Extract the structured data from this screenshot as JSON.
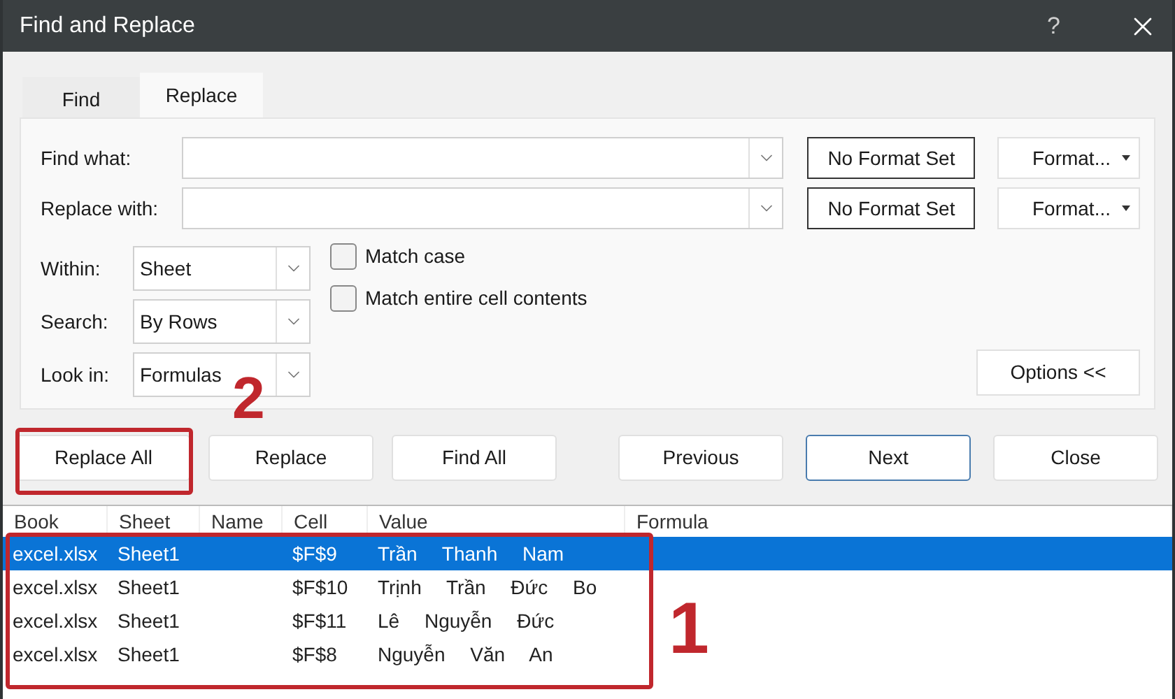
{
  "window": {
    "title": "Find and Replace",
    "help": "?"
  },
  "tabs": [
    {
      "label": "Find",
      "selected": false
    },
    {
      "label": "Replace",
      "selected": true
    }
  ],
  "fields": [
    {
      "label": "Find what:",
      "format_status": "No Format Set",
      "format_button": "Format..."
    },
    {
      "label": "Replace with:",
      "format_status": "No Format Set",
      "format_button": "Format..."
    }
  ],
  "selects": [
    {
      "label": "Within:",
      "value": "Sheet"
    },
    {
      "label": "Search:",
      "value": "By Rows"
    },
    {
      "label": "Look in:",
      "value": "Formulas"
    }
  ],
  "checkboxes": [
    {
      "label": "Match case",
      "checked": false
    },
    {
      "label": "Match entire cell contents",
      "checked": false
    }
  ],
  "options_button": "Options <<",
  "buttons": [
    {
      "label": "Replace All",
      "default": false
    },
    {
      "label": "Replace",
      "default": false
    },
    {
      "label": "Find All",
      "default": false
    },
    {
      "label": "Previous",
      "default": false
    },
    {
      "label": "Next",
      "default": true
    },
    {
      "label": "Close",
      "default": false
    }
  ],
  "results": {
    "columns": [
      "Book",
      "Sheet",
      "Name",
      "Cell",
      "Value",
      "Formula"
    ],
    "rows": [
      {
        "cells": [
          "excel.xlsx",
          "Sheet1",
          "",
          "$F$9",
          "Trần Thanh Nam",
          ""
        ],
        "selected": true
      },
      {
        "cells": [
          "excel.xlsx",
          "Sheet1",
          "",
          "$F$10",
          "Trịnh Trần Đức Bo",
          ""
        ],
        "selected": false
      },
      {
        "cells": [
          "excel.xlsx",
          "Sheet1",
          "",
          "$F$11",
          "Lê Nguyễn Đức",
          ""
        ],
        "selected": false
      },
      {
        "cells": [
          "excel.xlsx",
          "Sheet1",
          "",
          "$F$8",
          "Nguyễn Văn An",
          ""
        ],
        "selected": false
      }
    ]
  },
  "annotations": {
    "buttons_marker": "2",
    "results_marker": "1"
  }
}
